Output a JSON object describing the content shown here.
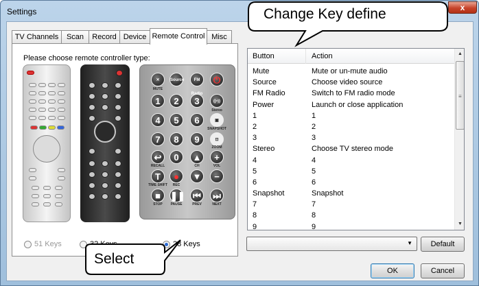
{
  "window": {
    "title": "Settings",
    "close_glyph": "x"
  },
  "tabs": [
    {
      "label": "TV Channels"
    },
    {
      "label": "Scan"
    },
    {
      "label": "Record"
    },
    {
      "label": "Device"
    },
    {
      "label": "Remote Control",
      "active": true
    },
    {
      "label": "Misc"
    }
  ],
  "remote_panel": {
    "prompt": "Please choose remote controller type:",
    "keys28": {
      "row1": [
        "Source",
        "FM Radio"
      ],
      "labels": [
        "MUTE",
        "Stereo",
        "SNAPSHOT",
        "ZOOM",
        "RECALL",
        "CH",
        "VOL",
        "TIME SHIFT",
        "REC",
        "STOP",
        "PAUSE",
        "PREV",
        "NEXT"
      ],
      "digits": [
        "1",
        "2",
        "3",
        "4",
        "5",
        "6",
        "7",
        "8",
        "9",
        "0"
      ],
      "letter": "T"
    },
    "options": [
      {
        "label": "51 Keys",
        "selected": false,
        "enabled": false
      },
      {
        "label": "32 Keys",
        "selected": false,
        "enabled": true
      },
      {
        "label": "28 Keys",
        "selected": true,
        "enabled": true
      }
    ]
  },
  "key_list": {
    "columns": [
      "Button",
      "Action"
    ],
    "rows": [
      [
        "Mute",
        "Mute or un-mute audio"
      ],
      [
        "Source",
        "Choose video source"
      ],
      [
        "FM Radio",
        "Switch to FM radio mode"
      ],
      [
        "Power",
        "Launch or close application"
      ],
      [
        "1",
        "1"
      ],
      [
        "2",
        "2"
      ],
      [
        "3",
        "3"
      ],
      [
        "Stereo",
        "Choose TV stereo mode"
      ],
      [
        "4",
        "4"
      ],
      [
        "5",
        "5"
      ],
      [
        "6",
        "6"
      ],
      [
        "Snapshot",
        "Snapshot"
      ],
      [
        "7",
        "7"
      ],
      [
        "8",
        "8"
      ],
      [
        "9",
        "9"
      ]
    ],
    "scroll_up": "▲",
    "scroll_down": "▼",
    "grip": "≡"
  },
  "action_dropdown": {
    "value": "",
    "arrow": "▼"
  },
  "buttons": {
    "default": "Default",
    "ok": "OK",
    "cancel": "Cancel"
  },
  "callouts": {
    "top": "Change Key define",
    "bottom": "Select"
  }
}
